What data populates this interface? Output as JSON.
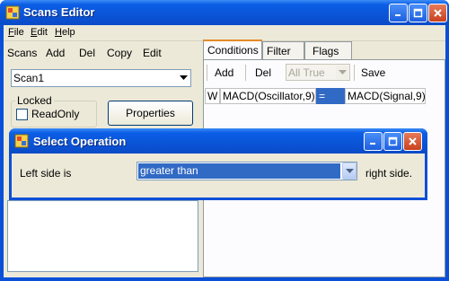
{
  "window": {
    "title": "Scans Editor"
  },
  "menu": {
    "file": "File",
    "edit": "Edit",
    "help": "Help",
    "file_u": "F",
    "file_rest": "ile",
    "edit_u": "E",
    "edit_rest": "dit",
    "help_u": "H",
    "help_rest": "elp"
  },
  "left_toolbar": {
    "scans": "Scans",
    "add": "Add",
    "del": "Del",
    "copy": "Copy",
    "edit": "Edit"
  },
  "scan_combo": {
    "value": "Scan1"
  },
  "locked_group": {
    "label": "Locked",
    "readonly_label": "ReadOnly",
    "readonly_checked": false
  },
  "properties_button": "Properties",
  "tabs": [
    {
      "label": "Conditions"
    },
    {
      "label": "Filter"
    },
    {
      "label": "Flags"
    }
  ],
  "right_toolbar": {
    "add": "Add",
    "del": "Del",
    "mode_value": "All True",
    "save": "Save"
  },
  "condition_row": {
    "prefix": "W",
    "left": "MACD(Oscillator,9)",
    "operator": "=",
    "right": "MACD(Signal,9)"
  },
  "dialog": {
    "title": "Select Operation",
    "left_label": "Left side is",
    "selected": "greater than",
    "right_label": "right side."
  },
  "colors": {
    "title_blue": "#0a54d6",
    "face": "#ece9d8",
    "selection": "#316ac5",
    "close_red": "#c8411e"
  }
}
